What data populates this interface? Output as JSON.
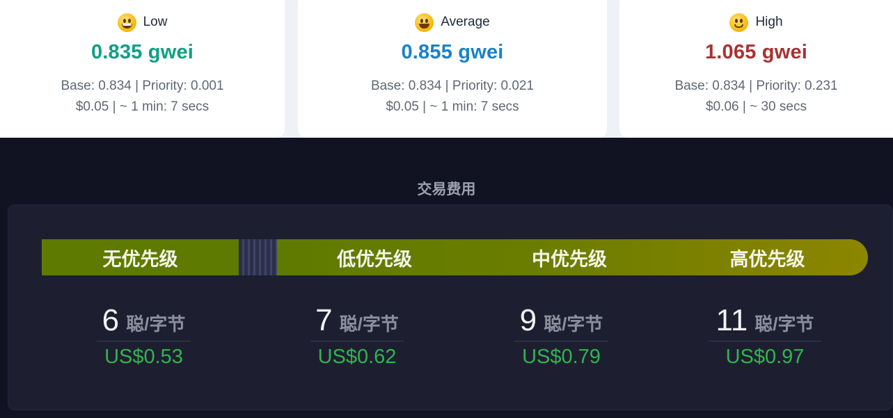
{
  "gas_tracker": {
    "low": {
      "label": "Low",
      "emoji_icon": "grinning-face-icon",
      "price": "0.835 gwei",
      "base_priority": "Base: 0.834 | Priority: 0.001",
      "cost_time": "$0.05 | ~ 1 min: 7 secs",
      "color": "#0f9f84"
    },
    "average": {
      "label": "Average",
      "emoji_icon": "big-smile-face-icon",
      "price": "0.855 gwei",
      "base_priority": "Base: 0.834 | Priority: 0.021",
      "cost_time": "$0.05 | ~ 1 min: 7 secs",
      "color": "#1a82c6"
    },
    "high": {
      "label": "High",
      "emoji_icon": "slightly-smiling-face-icon",
      "price": "1.065 gwei",
      "base_priority": "Base: 0.834 | Priority: 0.231",
      "cost_time": "$0.06 | ~ 30 secs",
      "color": "#a83232"
    }
  },
  "fee_panel": {
    "title": "交易费用",
    "bar": {
      "none": "无优先级",
      "low": "低优先级",
      "mid": "中优先级",
      "high": "高优先级",
      "color_start": "#5f7a00",
      "color_end": "#8c8600"
    },
    "stats": [
      {
        "value": "6",
        "unit": "聪/字节",
        "usd": "US$0.53"
      },
      {
        "value": "7",
        "unit": "聪/字节",
        "usd": "US$0.62"
      },
      {
        "value": "9",
        "unit": "聪/字节",
        "usd": "US$0.79"
      },
      {
        "value": "11",
        "unit": "聪/字节",
        "usd": "US$0.97"
      }
    ],
    "usd_color": "#32b44d"
  }
}
